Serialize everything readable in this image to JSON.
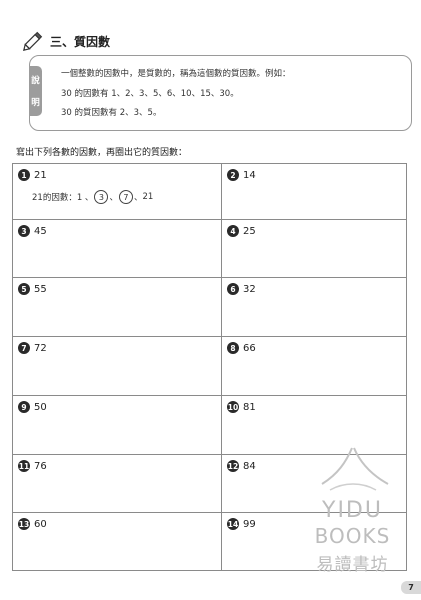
{
  "section": {
    "title": "三、質因數"
  },
  "explanation": {
    "tag_chars": [
      "說",
      "明"
    ],
    "lines": [
      "一個整數的因數中，是質數的，稱為這個數的質因數。例如：",
      "30 的因數有 1、2、3、5、6、10、15、30。",
      "30 的質因數有 2、3、5。"
    ]
  },
  "instruction": "寫出下列各數的因數，再圈出它的質因數：",
  "problems": [
    {
      "badge": "1",
      "value": "21"
    },
    {
      "badge": "2",
      "value": "14"
    },
    {
      "badge": "3",
      "value": "45"
    },
    {
      "badge": "4",
      "value": "25"
    },
    {
      "badge": "5",
      "value": "55"
    },
    {
      "badge": "6",
      "value": "32"
    },
    {
      "badge": "7",
      "value": "72"
    },
    {
      "badge": "8",
      "value": "66"
    },
    {
      "badge": "9",
      "value": "50"
    },
    {
      "badge": "10",
      "value": "81"
    },
    {
      "badge": "11",
      "value": "76"
    },
    {
      "badge": "12",
      "value": "84"
    },
    {
      "badge": "13",
      "value": "60"
    },
    {
      "badge": "14",
      "value": "99"
    }
  ],
  "example": {
    "prefix": "21的因數：1 、",
    "circled": [
      "3",
      "7"
    ],
    "sep1": "、",
    "sep2": "、",
    "suffix": " 21"
  },
  "watermark": {
    "line1": "YIDU",
    "line2": "BOOKS",
    "line3": "易讀書坊"
  },
  "page_number": "7",
  "colors": {
    "tag_bg": "#9c9c9c",
    "badge_bg": "#2a2a2a",
    "watermark": "#bdbdbd"
  }
}
